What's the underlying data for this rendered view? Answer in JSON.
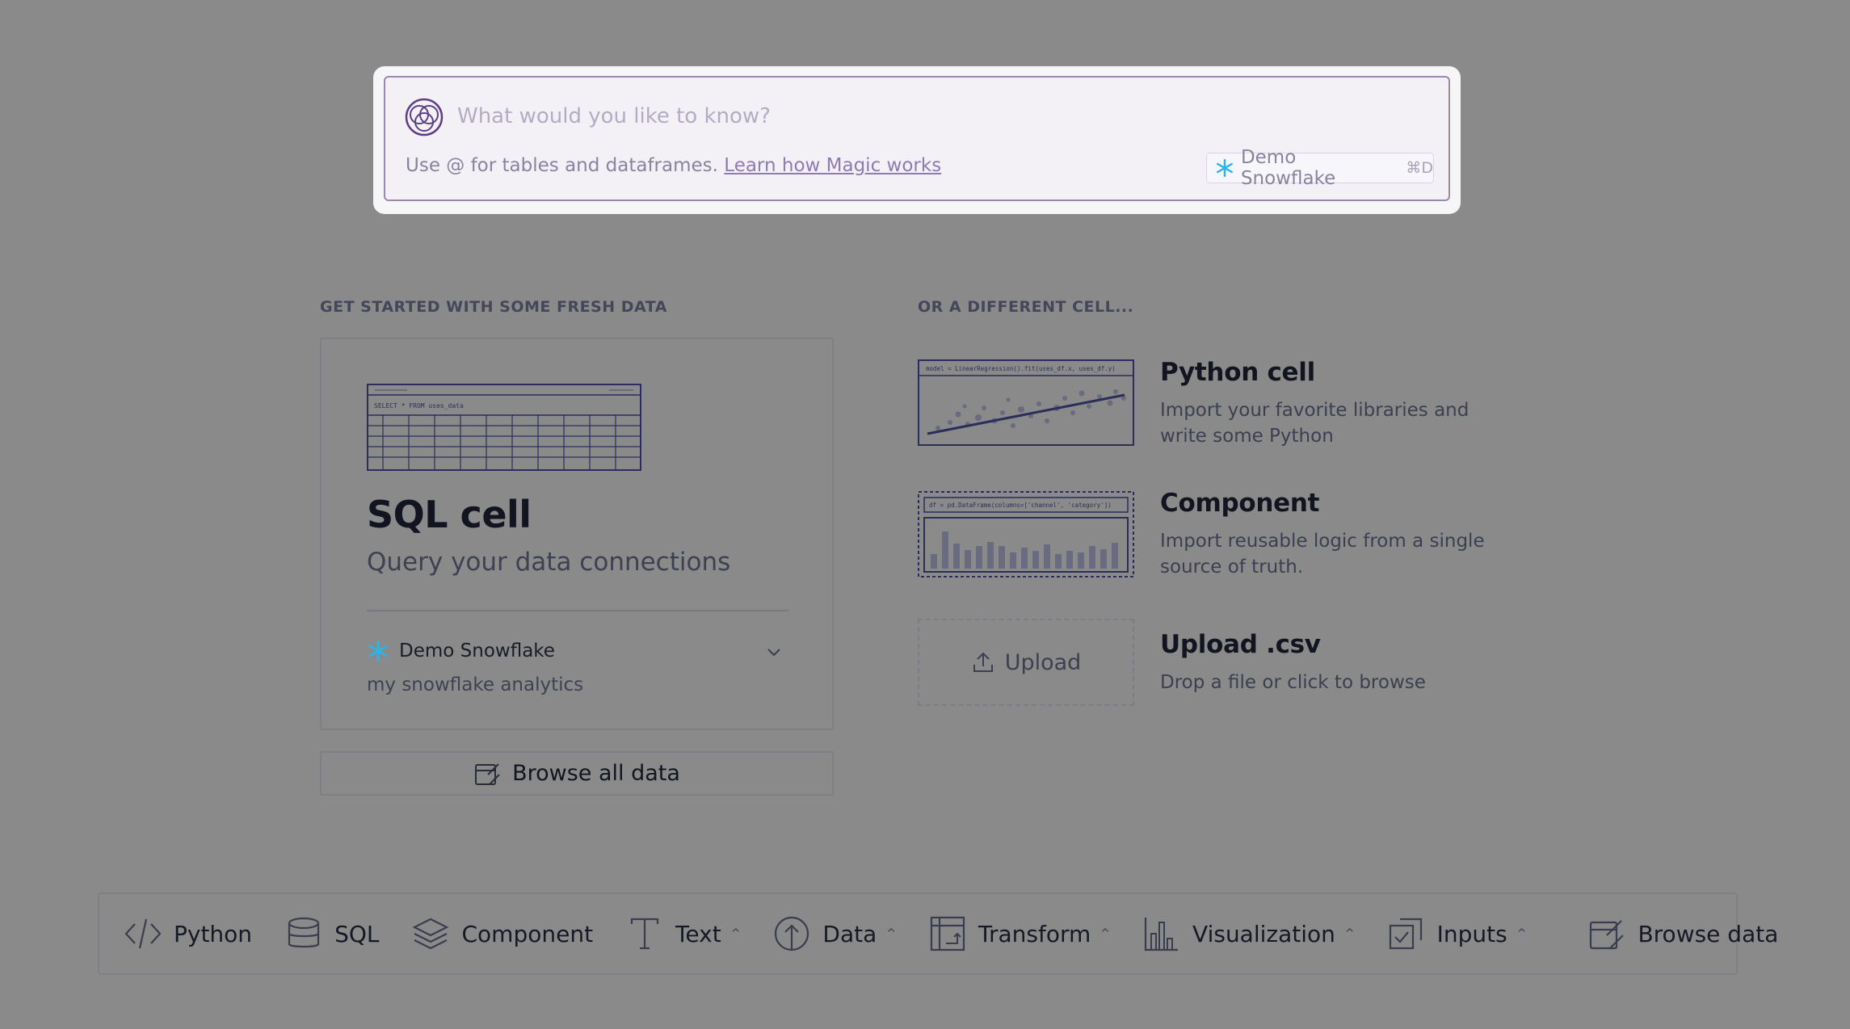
{
  "magic": {
    "placeholder": "What would you like to know?",
    "hint": "Use @ for tables and dataframes.",
    "link": "Learn how Magic works",
    "connection": "Demo Snowflake",
    "shortcut": "⌘D"
  },
  "left_section": {
    "title": "GET STARTED WITH SOME FRESH DATA",
    "card": {
      "illustration_query": "SELECT * FROM uses_data",
      "title": "SQL cell",
      "subtitle": "Query your data connections",
      "connection_name": "Demo Snowflake",
      "connection_desc": "my snowflake analytics"
    },
    "browse_label": "Browse all data"
  },
  "right_section": {
    "title": "OR A DIFFERENT CELL...",
    "cells": [
      {
        "title": "Python cell",
        "desc": "Import your favorite libraries and write some Python",
        "code": "model = LinearRegression().fit(uses_df.x, uses_df.y)"
      },
      {
        "title": "Component",
        "desc": "Import reusable logic from a single source of truth.",
        "code": "df = pd.DataFrame(columns=['channel', 'category'])"
      },
      {
        "title": "Upload .csv",
        "desc": "Drop a file or click to browse",
        "button": "Upload"
      }
    ]
  },
  "toolbar": {
    "items": [
      {
        "label": "Python",
        "icon": "code-icon"
      },
      {
        "label": "SQL",
        "icon": "database-icon"
      },
      {
        "label": "Component",
        "icon": "layers-icon"
      },
      {
        "label": "Text",
        "icon": "text-icon",
        "caret": true
      },
      {
        "label": "Data",
        "icon": "upload-circle-icon",
        "caret": true
      },
      {
        "label": "Transform",
        "icon": "transform-icon",
        "caret": true
      },
      {
        "label": "Visualization",
        "icon": "bar-chart-icon",
        "caret": true
      },
      {
        "label": "Inputs",
        "icon": "checkbox-icon",
        "caret": true
      },
      {
        "label": "Browse data",
        "icon": "browse-data-icon"
      }
    ]
  },
  "colors": {
    "backdrop": "#8a8a8a",
    "accent_purple": "#6b4f9a",
    "snowflake": "#29b5e8"
  }
}
